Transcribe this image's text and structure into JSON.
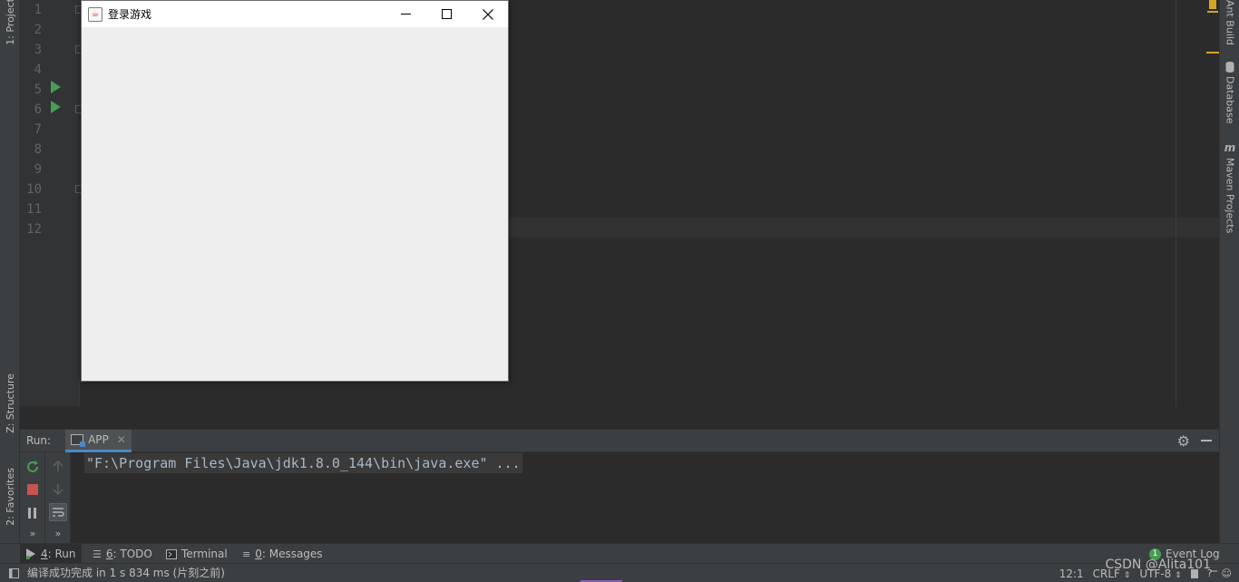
{
  "left_strip": {
    "project_tab": "1: Project",
    "structure_tab": "Z: Structure",
    "favorites_tab": "2: Favorites"
  },
  "right_strip": {
    "ant_tab": "Ant Build",
    "database_tab": "Database",
    "maven_tab": "Maven Projects"
  },
  "editor": {
    "line_numbers": [
      "1",
      "2",
      "3",
      "4",
      "5",
      "6",
      "7",
      "8",
      "9",
      "10",
      "11",
      "12"
    ],
    "current_line": 12
  },
  "app_window": {
    "title": "登录游戏",
    "icon": "java-cup-icon"
  },
  "run_panel": {
    "label": "Run:",
    "tab_label": "APP",
    "console_text": "\"F:\\Program Files\\Java\\jdk1.8.0_144\\bin\\java.exe\" ..."
  },
  "tool_windows": {
    "run": {
      "key": "4",
      "label": ": Run"
    },
    "todo": {
      "key": "6",
      "label": ": TODO"
    },
    "terminal": {
      "label": "Terminal"
    },
    "messages": {
      "key": "0",
      "label": ": Messages"
    },
    "event_log": {
      "label": "Event Log",
      "count": "1"
    }
  },
  "status_bar": {
    "message": "编译成功完成 in 1 s 834 ms (片刻之前)",
    "position": "12:1",
    "line_sep": "CRLF",
    "encoding": "UTF-8"
  },
  "watermark": "CSDN @Alita101_",
  "colors": {
    "ide_bg": "#2b2b2b",
    "panel_bg": "#3c3f41",
    "run_green": "#499c54",
    "stop_red": "#c75450",
    "accent_blue": "#4a88c7",
    "window_bg": "#eeeeee"
  }
}
